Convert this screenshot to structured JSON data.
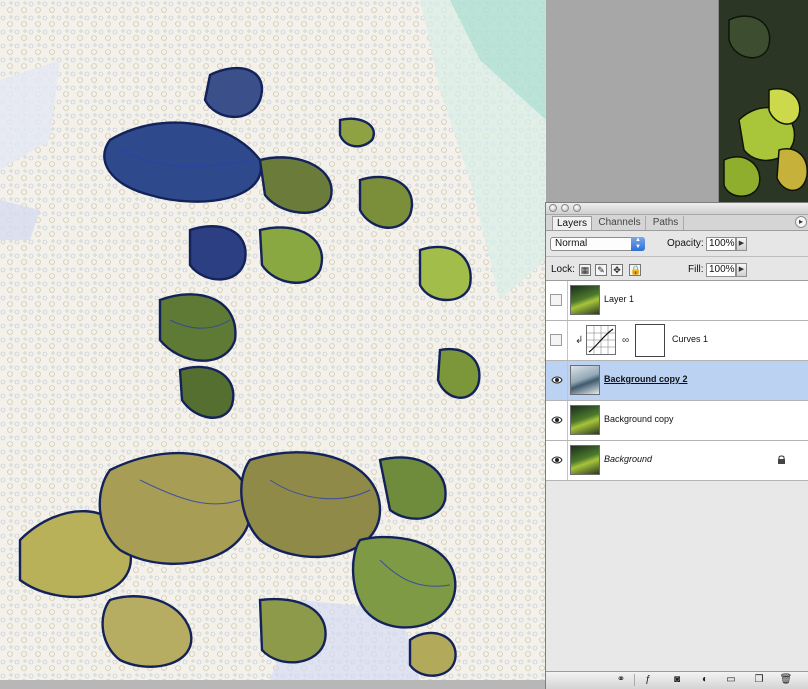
{
  "panel": {
    "tabs": [
      {
        "label": "Layers",
        "active": true
      },
      {
        "label": "Channels",
        "active": false
      },
      {
        "label": "Paths",
        "active": false
      }
    ],
    "blend_mode": "Normal",
    "opacity_label": "Opacity:",
    "opacity_value": "100%",
    "lock_label": "Lock:",
    "fill_label": "Fill:",
    "fill_value": "100%"
  },
  "layers": [
    {
      "name": "Layer 1",
      "visible": false,
      "selected": false
    },
    {
      "name": "Curves 1",
      "visible": false,
      "selected": false
    },
    {
      "name": "Background copy 2",
      "visible": true,
      "selected": true
    },
    {
      "name": "Background copy",
      "visible": true,
      "selected": false
    },
    {
      "name": "Background",
      "visible": true,
      "selected": false,
      "locked": true
    }
  ],
  "icons": {
    "eye": "eye-icon",
    "lock": "lock-icon",
    "link": "link-icon",
    "clip": "clip-arrow-icon"
  },
  "colors": {
    "selected_row": "#bcd2f3",
    "panel_bg": "#e8e8e8",
    "blue_control": "#2f6fd6"
  }
}
